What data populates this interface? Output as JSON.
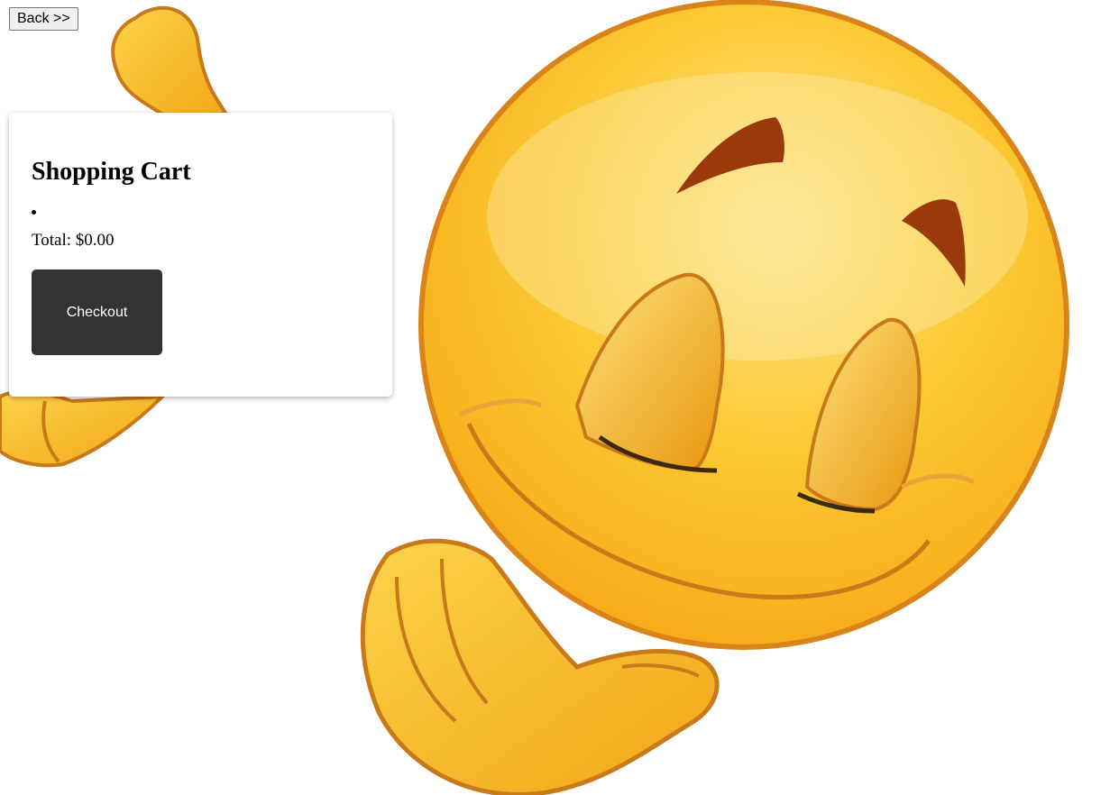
{
  "nav": {
    "back_label": "Back >>"
  },
  "cart": {
    "title": "Shopping Cart",
    "items": [
      ""
    ],
    "total_label": "Total: $0.00",
    "checkout_label": "Checkout"
  },
  "background": {
    "icon": "smiling-emoji-icon",
    "colors": {
      "face": "#f9b51b",
      "face_highlight": "#fde27a",
      "outline": "#c9781a",
      "brow": "#9a3a0a"
    }
  }
}
